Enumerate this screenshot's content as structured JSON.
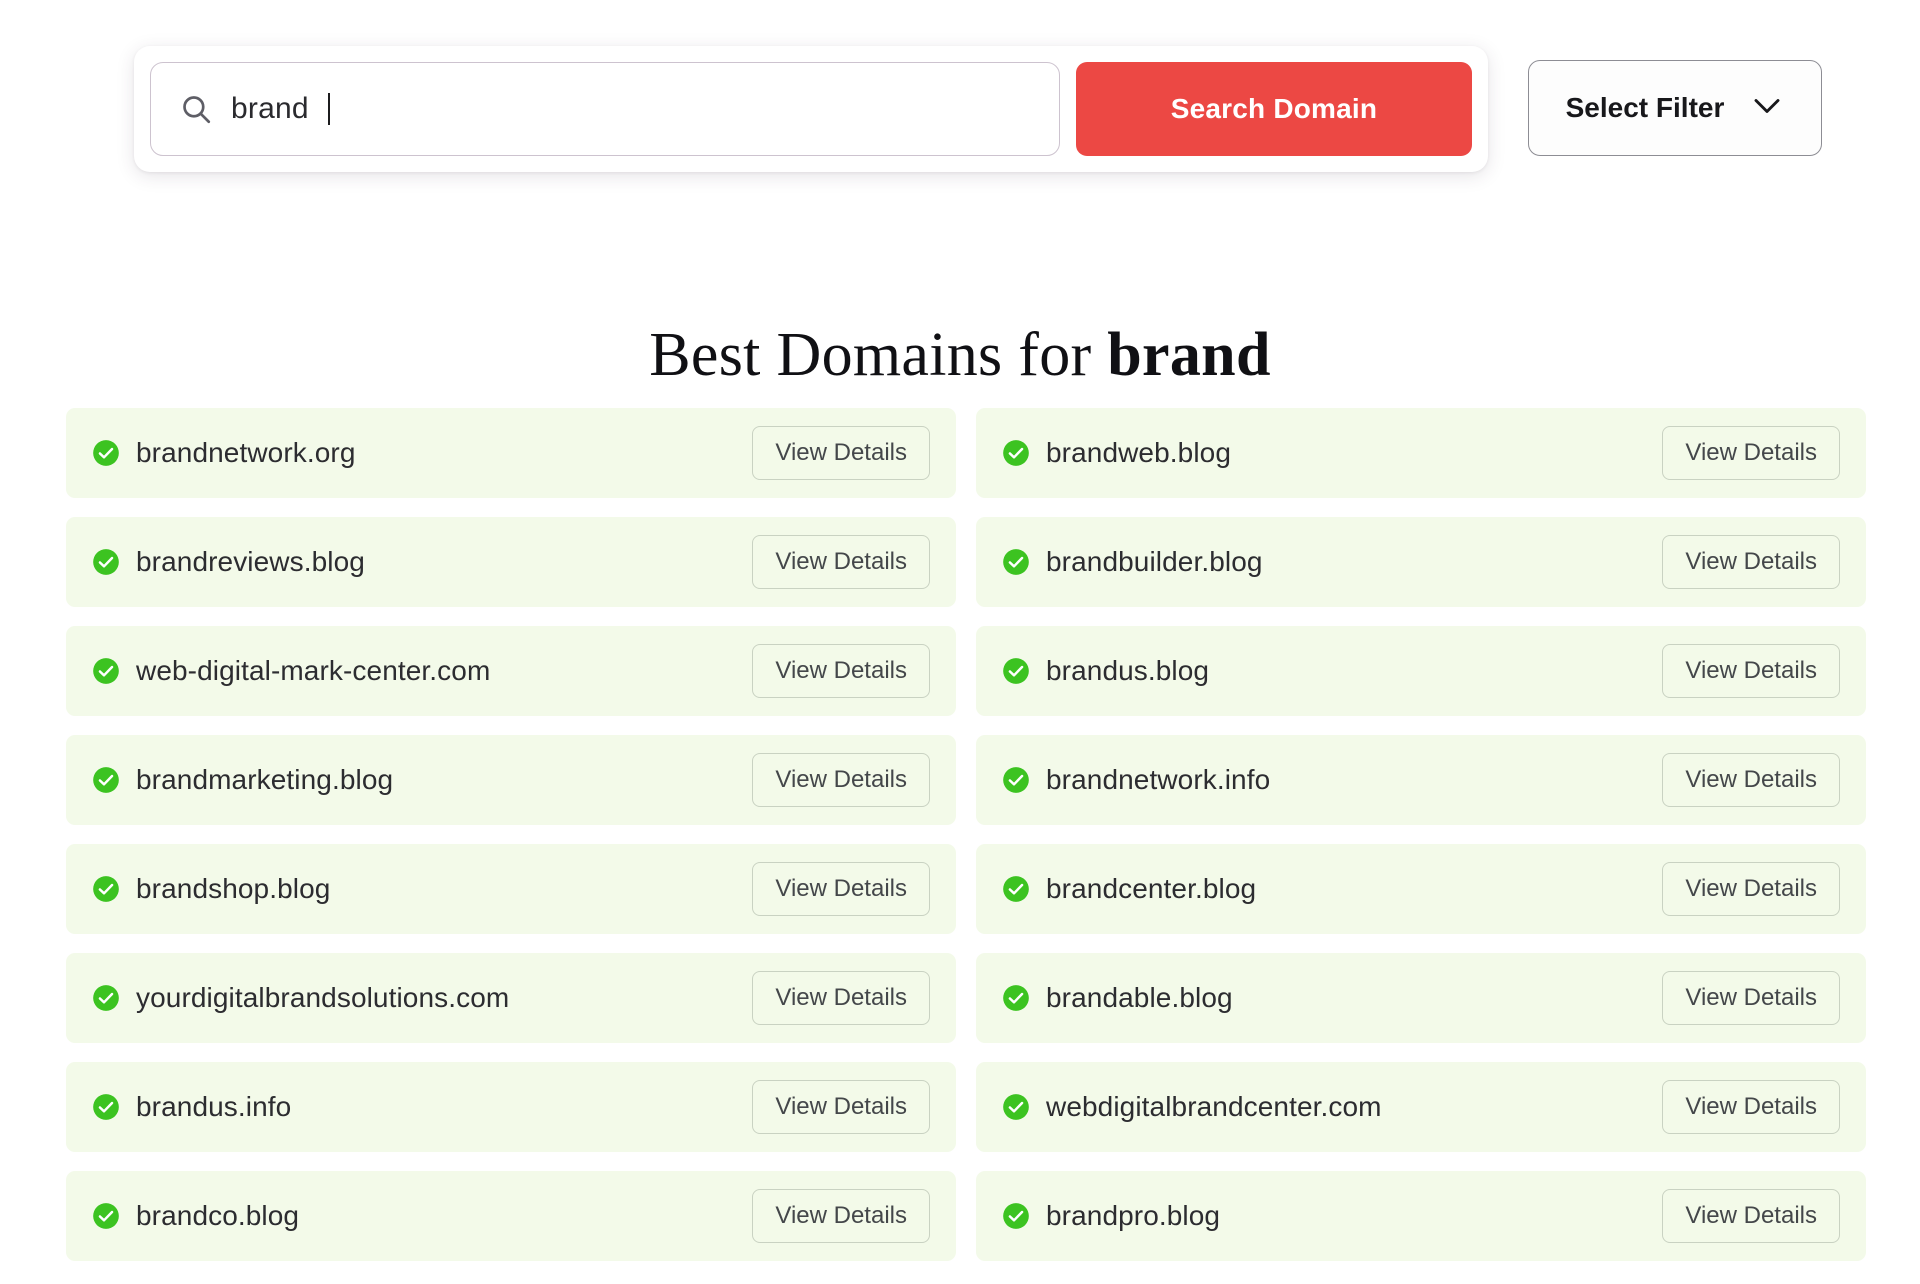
{
  "search": {
    "value": "brand",
    "placeholder": "Search domain",
    "icon": "search-icon",
    "submit_label": "Search Domain",
    "filter_label": "Select Filter",
    "filter_icon": "chevron-down-icon"
  },
  "heading": {
    "prefix": "Best Domains for ",
    "keyword": "brand"
  },
  "results": {
    "details_label": "View Details",
    "status_icon": "check-circle-icon",
    "status_color": "#3cc321",
    "row_background": "#f3fae9",
    "items": [
      {
        "domain": "brandnetwork.org"
      },
      {
        "domain": "brandweb.blog"
      },
      {
        "domain": "brandreviews.blog"
      },
      {
        "domain": "brandbuilder.blog"
      },
      {
        "domain": "web-digital-mark-center.com"
      },
      {
        "domain": "brandus.blog"
      },
      {
        "domain": "brandmarketing.blog"
      },
      {
        "domain": "brandnetwork.info"
      },
      {
        "domain": "brandshop.blog"
      },
      {
        "domain": "brandcenter.blog"
      },
      {
        "domain": "yourdigitalbrandsolutions.com"
      },
      {
        "domain": "brandable.blog"
      },
      {
        "domain": "brandus.info"
      },
      {
        "domain": "webdigitalbrandcenter.com"
      },
      {
        "domain": "brandco.blog"
      },
      {
        "domain": "brandpro.blog"
      }
    ]
  },
  "colors": {
    "accent_red": "#ec4844",
    "status_green": "#3cc321",
    "row_green": "#f3fae9"
  }
}
